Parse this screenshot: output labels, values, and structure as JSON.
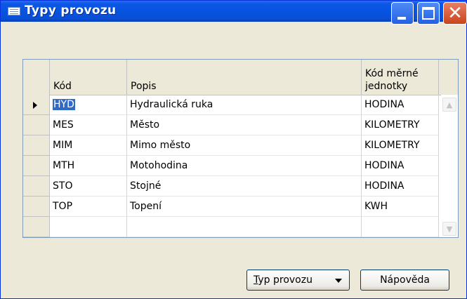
{
  "window": {
    "title": "Typy provozu",
    "icon": "form-icon"
  },
  "controls": {
    "minimize": "minimize-icon",
    "maximize": "maximize-icon",
    "close": "close-icon"
  },
  "table": {
    "columns": [
      "Kód",
      "Popis",
      "Kód měrné\njednotky"
    ],
    "rows": [
      {
        "kod": "HYD",
        "popis": "Hydraulická ruka",
        "jednotka": "HODINA"
      },
      {
        "kod": "MES",
        "popis": "Město",
        "jednotka": "KILOMETRY"
      },
      {
        "kod": "MIM",
        "popis": "Mimo město",
        "jednotka": "KILOMETRY"
      },
      {
        "kod": "MTH",
        "popis": "Motohodina",
        "jednotka": "HODINA"
      },
      {
        "kod": "STO",
        "popis": "Stojné",
        "jednotka": "HODINA"
      },
      {
        "kod": "TOP",
        "popis": "Topení",
        "jednotka": "KWH"
      },
      {
        "kod": "",
        "popis": "",
        "jednotka": ""
      }
    ]
  },
  "buttons": {
    "type_menu": "Typ provozu",
    "type_menu_hotkey": "T",
    "type_menu_rest": "yp provozu",
    "help": "Nápověda"
  },
  "colors": {
    "titlebar": "#0654e0",
    "selection": "#316ac5"
  }
}
